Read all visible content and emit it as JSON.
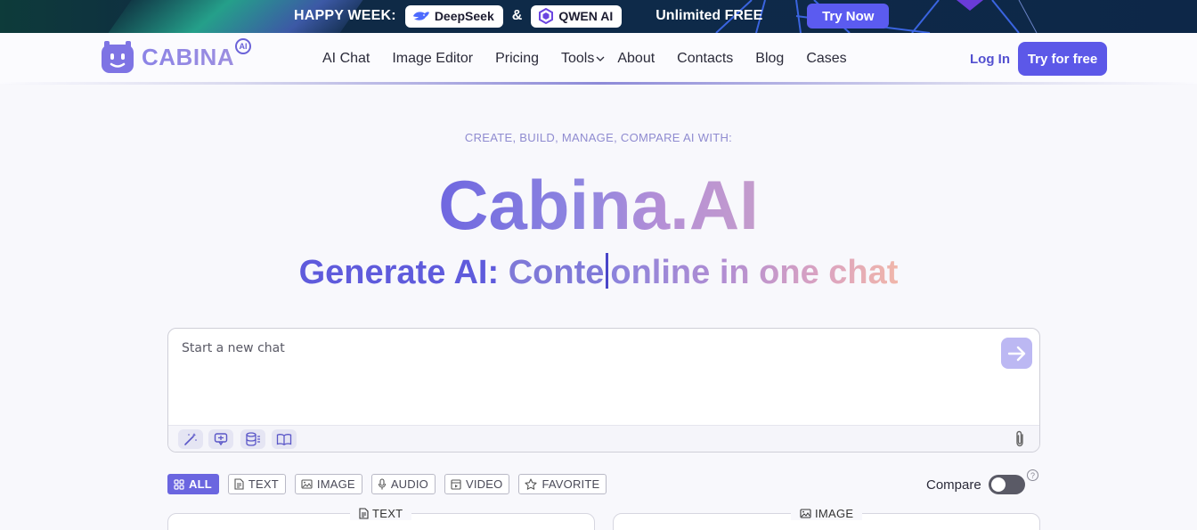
{
  "promo": {
    "happy_week": "HAPPY WEEK:",
    "deepseek": "DeepSeek",
    "amp": "&",
    "qwen": "QWEN AI",
    "unlimited": "Unlimited FREE",
    "try_now": "Try Now"
  },
  "nav": {
    "logo_text": "CABINA",
    "logo_badge": "AI",
    "items": [
      "AI Chat",
      "Image Editor",
      "Pricing",
      "Tools",
      "About",
      "Contacts",
      "Blog",
      "Cases"
    ],
    "login": "Log In",
    "try_free": "Try for free"
  },
  "hero": {
    "eyebrow": "CREATE, BUILD, MANAGE, COMPARE AI WITH:",
    "title": "Cabina.AI",
    "sub_prefix": "Generate AI:",
    "sub_typed": "Conte",
    "sub_rest": "online in one chat"
  },
  "chat": {
    "placeholder": "Start a new chat"
  },
  "filters": {
    "items": [
      "ALL",
      "TEXT",
      "IMAGE",
      "AUDIO",
      "VIDEO",
      "FAVORITE"
    ],
    "active": "ALL"
  },
  "compare": {
    "label": "Compare",
    "enabled": false,
    "help": "?"
  },
  "cards": {
    "text_label": "TEXT",
    "image_label": "IMAGE"
  },
  "colors": {
    "accent": "#5c58e8",
    "banner_bg": "#0e2a49",
    "page_bg": "#f8f8fc"
  }
}
